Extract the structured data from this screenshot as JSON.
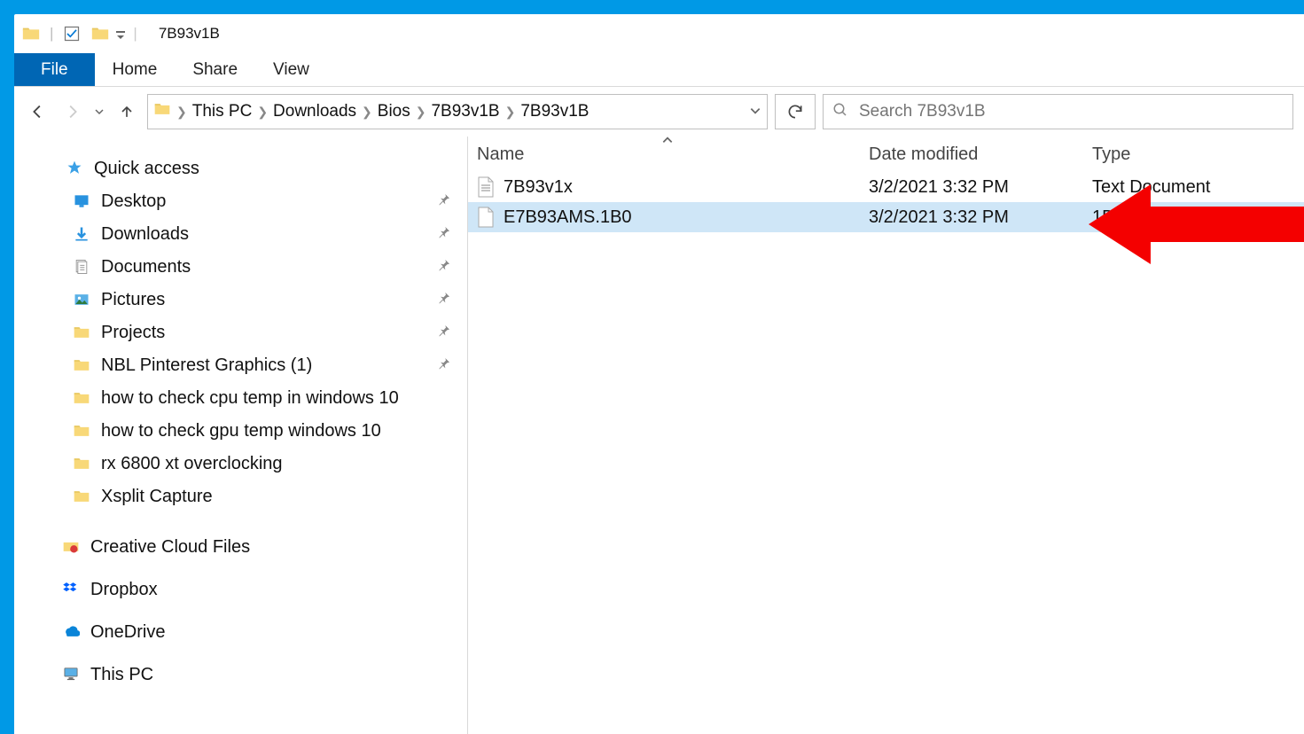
{
  "titlebar": {
    "title": "7B93v1B"
  },
  "ribbon": {
    "file": "File",
    "tabs": [
      "Home",
      "Share",
      "View"
    ]
  },
  "breadcrumb": [
    "This PC",
    "Downloads",
    "Bios",
    "7B93v1B",
    "7B93v1B"
  ],
  "search": {
    "placeholder": "Search 7B93v1B"
  },
  "sidebar": {
    "quick_access": "Quick access",
    "items": [
      {
        "label": "Desktop",
        "pinned": true,
        "icon": "desktop"
      },
      {
        "label": "Downloads",
        "pinned": true,
        "icon": "downloads"
      },
      {
        "label": "Documents",
        "pinned": true,
        "icon": "documents"
      },
      {
        "label": "Pictures",
        "pinned": true,
        "icon": "pictures"
      },
      {
        "label": "Projects",
        "pinned": true,
        "icon": "folder"
      },
      {
        "label": "NBL Pinterest Graphics (1)",
        "pinned": true,
        "icon": "folder"
      },
      {
        "label": "how to check cpu temp in windows 10",
        "pinned": false,
        "icon": "folder"
      },
      {
        "label": "how to check gpu temp windows 10",
        "pinned": false,
        "icon": "folder"
      },
      {
        "label": "rx 6800 xt overclocking",
        "pinned": false,
        "icon": "folder"
      },
      {
        "label": "Xsplit Capture",
        "pinned": false,
        "icon": "folder"
      }
    ],
    "storage": [
      {
        "label": "Creative Cloud Files",
        "icon": "ccloud"
      },
      {
        "label": "Dropbox",
        "icon": "dropbox"
      },
      {
        "label": "OneDrive",
        "icon": "onedrive"
      },
      {
        "label": "This PC",
        "icon": "thispc"
      }
    ]
  },
  "columns": {
    "name": "Name",
    "date": "Date modified",
    "type": "Type"
  },
  "files": [
    {
      "name": "7B93v1x",
      "date": "3/2/2021 3:32 PM",
      "type": "Text Document",
      "selected": false,
      "icon": "text"
    },
    {
      "name": "E7B93AMS.1B0",
      "date": "3/2/2021 3:32 PM",
      "type": "1B0 File",
      "selected": true,
      "icon": "blank"
    }
  ]
}
